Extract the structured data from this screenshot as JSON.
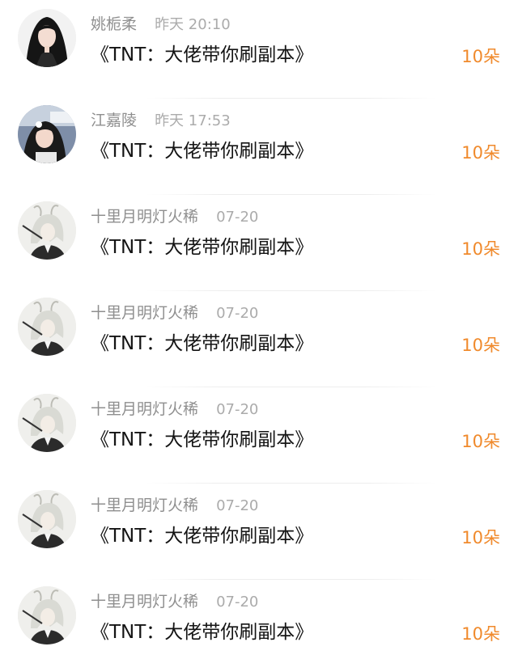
{
  "colors": {
    "username": "#8f8f8f",
    "timestamp": "#ababab",
    "title": "#141414",
    "gift_count": "#f08a2c"
  },
  "rows": [
    {
      "avatar_icon": "avatar-girl-black-hair-icon",
      "username": "姚栀柔",
      "time": "昨天 20:10",
      "title": "《TNT：大佬带你刷副本》",
      "count": "10朵"
    },
    {
      "avatar_icon": "avatar-girl-photo-icon",
      "username": "江嘉陵",
      "time": "昨天 17:53",
      "title": "《TNT：大佬带你刷副本》",
      "count": "10朵"
    },
    {
      "avatar_icon": "avatar-anime-white-hair-icon",
      "username": "十里月明灯火稀",
      "time": "07-20",
      "title": "《TNT：大佬带你刷副本》",
      "count": "10朵"
    },
    {
      "avatar_icon": "avatar-anime-white-hair-icon",
      "username": "十里月明灯火稀",
      "time": "07-20",
      "title": "《TNT：大佬带你刷副本》",
      "count": "10朵"
    },
    {
      "avatar_icon": "avatar-anime-white-hair-icon",
      "username": "十里月明灯火稀",
      "time": "07-20",
      "title": "《TNT：大佬带你刷副本》",
      "count": "10朵"
    },
    {
      "avatar_icon": "avatar-anime-white-hair-icon",
      "username": "十里月明灯火稀",
      "time": "07-20",
      "title": "《TNT：大佬带你刷副本》",
      "count": "10朵"
    },
    {
      "avatar_icon": "avatar-anime-white-hair-icon",
      "username": "十里月明灯火稀",
      "time": "07-20",
      "title": "《TNT：大佬带你刷副本》",
      "count": "10朵"
    }
  ]
}
